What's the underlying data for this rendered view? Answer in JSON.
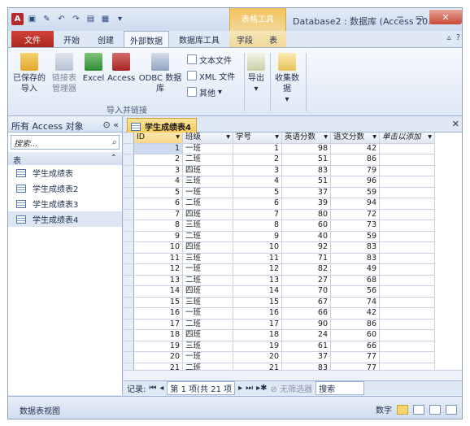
{
  "titlebar": {
    "context_tab": "表格工具",
    "window_title": "Database2 : 数据库 (Access 20..."
  },
  "tabs": [
    "文件",
    "开始",
    "创建",
    "外部数据",
    "数据库工具",
    "字段",
    "表"
  ],
  "ribbon": {
    "buttons": [
      {
        "label": "已保存的\n导入"
      },
      {
        "label": "链接表\n管理器"
      },
      {
        "label": "Excel"
      },
      {
        "label": "Access"
      },
      {
        "label": "ODBC 数据库"
      }
    ],
    "small_buttons": [
      "文本文件",
      "XML 文件",
      "其他"
    ],
    "group_label": "导入并链接",
    "export_label": "导出",
    "collect_label": "收集数据"
  },
  "nav": {
    "header": "所有 Access 对象",
    "search_placeholder": "搜索...",
    "group": "表",
    "items": [
      "学生成绩表",
      "学生成绩表2",
      "学生成绩表3",
      "学生成绩表4"
    ]
  },
  "document": {
    "tab_label": "学生成绩表4",
    "columns": [
      "ID",
      "班级",
      "学号",
      "英语分数",
      "语文分数",
      "单击以添加"
    ],
    "rows": [
      [
        "1",
        "一班",
        "1",
        "98",
        "42"
      ],
      [
        "2",
        "二班",
        "2",
        "51",
        "86"
      ],
      [
        "3",
        "四班",
        "3",
        "83",
        "79"
      ],
      [
        "4",
        "三班",
        "4",
        "51",
        "96"
      ],
      [
        "5",
        "一班",
        "5",
        "37",
        "59"
      ],
      [
        "6",
        "二班",
        "6",
        "39",
        "94"
      ],
      [
        "7",
        "四班",
        "7",
        "80",
        "72"
      ],
      [
        "8",
        "三班",
        "8",
        "60",
        "73"
      ],
      [
        "9",
        "二班",
        "9",
        "40",
        "59"
      ],
      [
        "10",
        "四班",
        "10",
        "92",
        "83"
      ],
      [
        "11",
        "三班",
        "11",
        "71",
        "83"
      ],
      [
        "12",
        "一班",
        "12",
        "82",
        "49"
      ],
      [
        "13",
        "二班",
        "13",
        "27",
        "68"
      ],
      [
        "14",
        "四班",
        "14",
        "70",
        "56"
      ],
      [
        "15",
        "三班",
        "15",
        "67",
        "74"
      ],
      [
        "16",
        "一班",
        "16",
        "66",
        "42"
      ],
      [
        "17",
        "二班",
        "17",
        "90",
        "86"
      ],
      [
        "18",
        "四班",
        "18",
        "24",
        "60"
      ],
      [
        "19",
        "三班",
        "19",
        "61",
        "66"
      ],
      [
        "20",
        "一班",
        "20",
        "37",
        "77"
      ],
      [
        "21",
        "二班",
        "21",
        "83",
        "77"
      ]
    ],
    "record_nav": {
      "label": "记录:",
      "position": "第 1 项(共 21 项",
      "filter": "无筛选器",
      "search": "搜索"
    }
  },
  "status": {
    "left": "数据表视图",
    "right": "数字"
  }
}
